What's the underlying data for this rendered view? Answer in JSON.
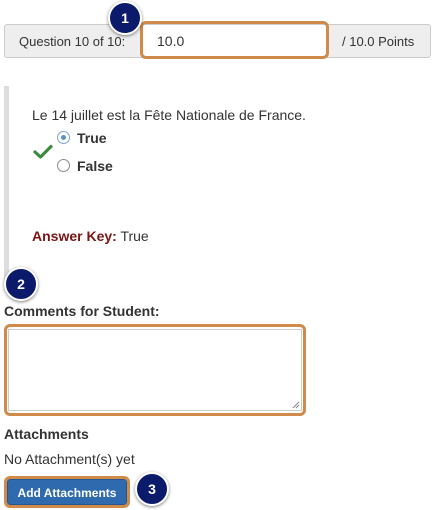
{
  "score": {
    "question_label": "Question 10 of 10:",
    "value": "10.0",
    "points_label": "/ 10.0 Points"
  },
  "callouts": [
    "1",
    "2",
    "3"
  ],
  "question": {
    "text": "Le 14 juillet est la Fête Nationale de France.",
    "result_icon": "checkmark-icon",
    "options": [
      {
        "label": "True",
        "selected": true
      },
      {
        "label": "False",
        "selected": false
      }
    ],
    "answer_key_label": "Answer Key:",
    "answer_key_value": "True"
  },
  "comments": {
    "label": "Comments for Student:",
    "value": ""
  },
  "attachments": {
    "heading": "Attachments",
    "status": "No Attachment(s) yet",
    "add_button_label": "Add Attachments"
  },
  "colors": {
    "highlight": "#d08a4a",
    "badge": "#0b1a6b",
    "button": "#2e6aad",
    "check": "#3c8a3c",
    "answer_key": "#7b1414"
  }
}
